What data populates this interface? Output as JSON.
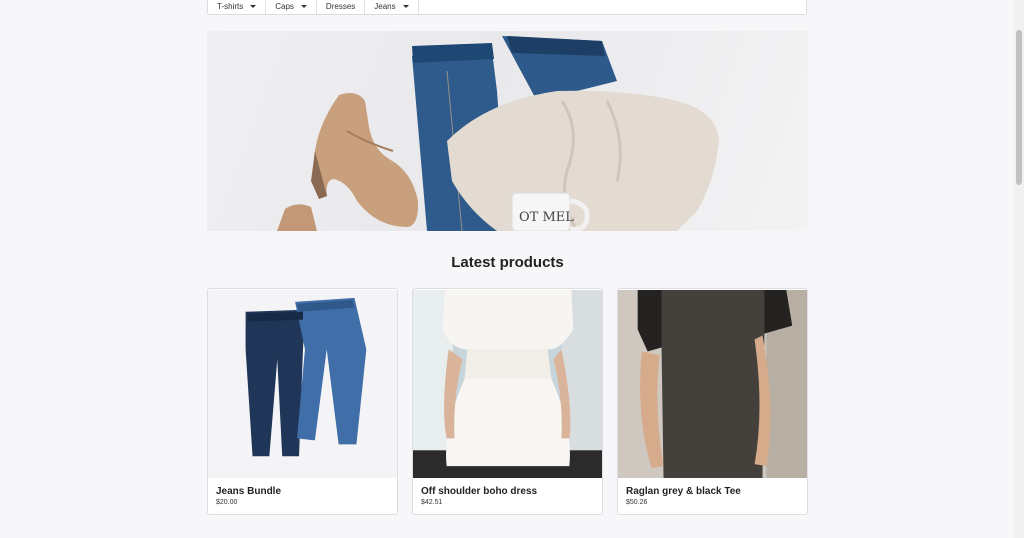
{
  "nav": {
    "items": [
      {
        "label": "T-shirts",
        "has_dropdown": true
      },
      {
        "label": "Caps",
        "has_dropdown": true
      },
      {
        "label": "Dresses",
        "has_dropdown": false
      },
      {
        "label": "Jeans",
        "has_dropdown": true
      }
    ]
  },
  "hero": {
    "mug_text": "OT MEL"
  },
  "section": {
    "title": "Latest products"
  },
  "products": [
    {
      "name": "Jeans Bundle",
      "price": "$20.00"
    },
    {
      "name": "Off shoulder boho dress",
      "price": "$42.51"
    },
    {
      "name": "Raglan grey & black Tee",
      "price": "$50.26"
    }
  ],
  "colors": {
    "background": "#f7f7fa",
    "denim_dark": "#1f3658",
    "denim_light": "#3f6ea8",
    "sweater": "#e6dfd6",
    "boot": "#c49a78",
    "tee": "#3e3b37"
  }
}
